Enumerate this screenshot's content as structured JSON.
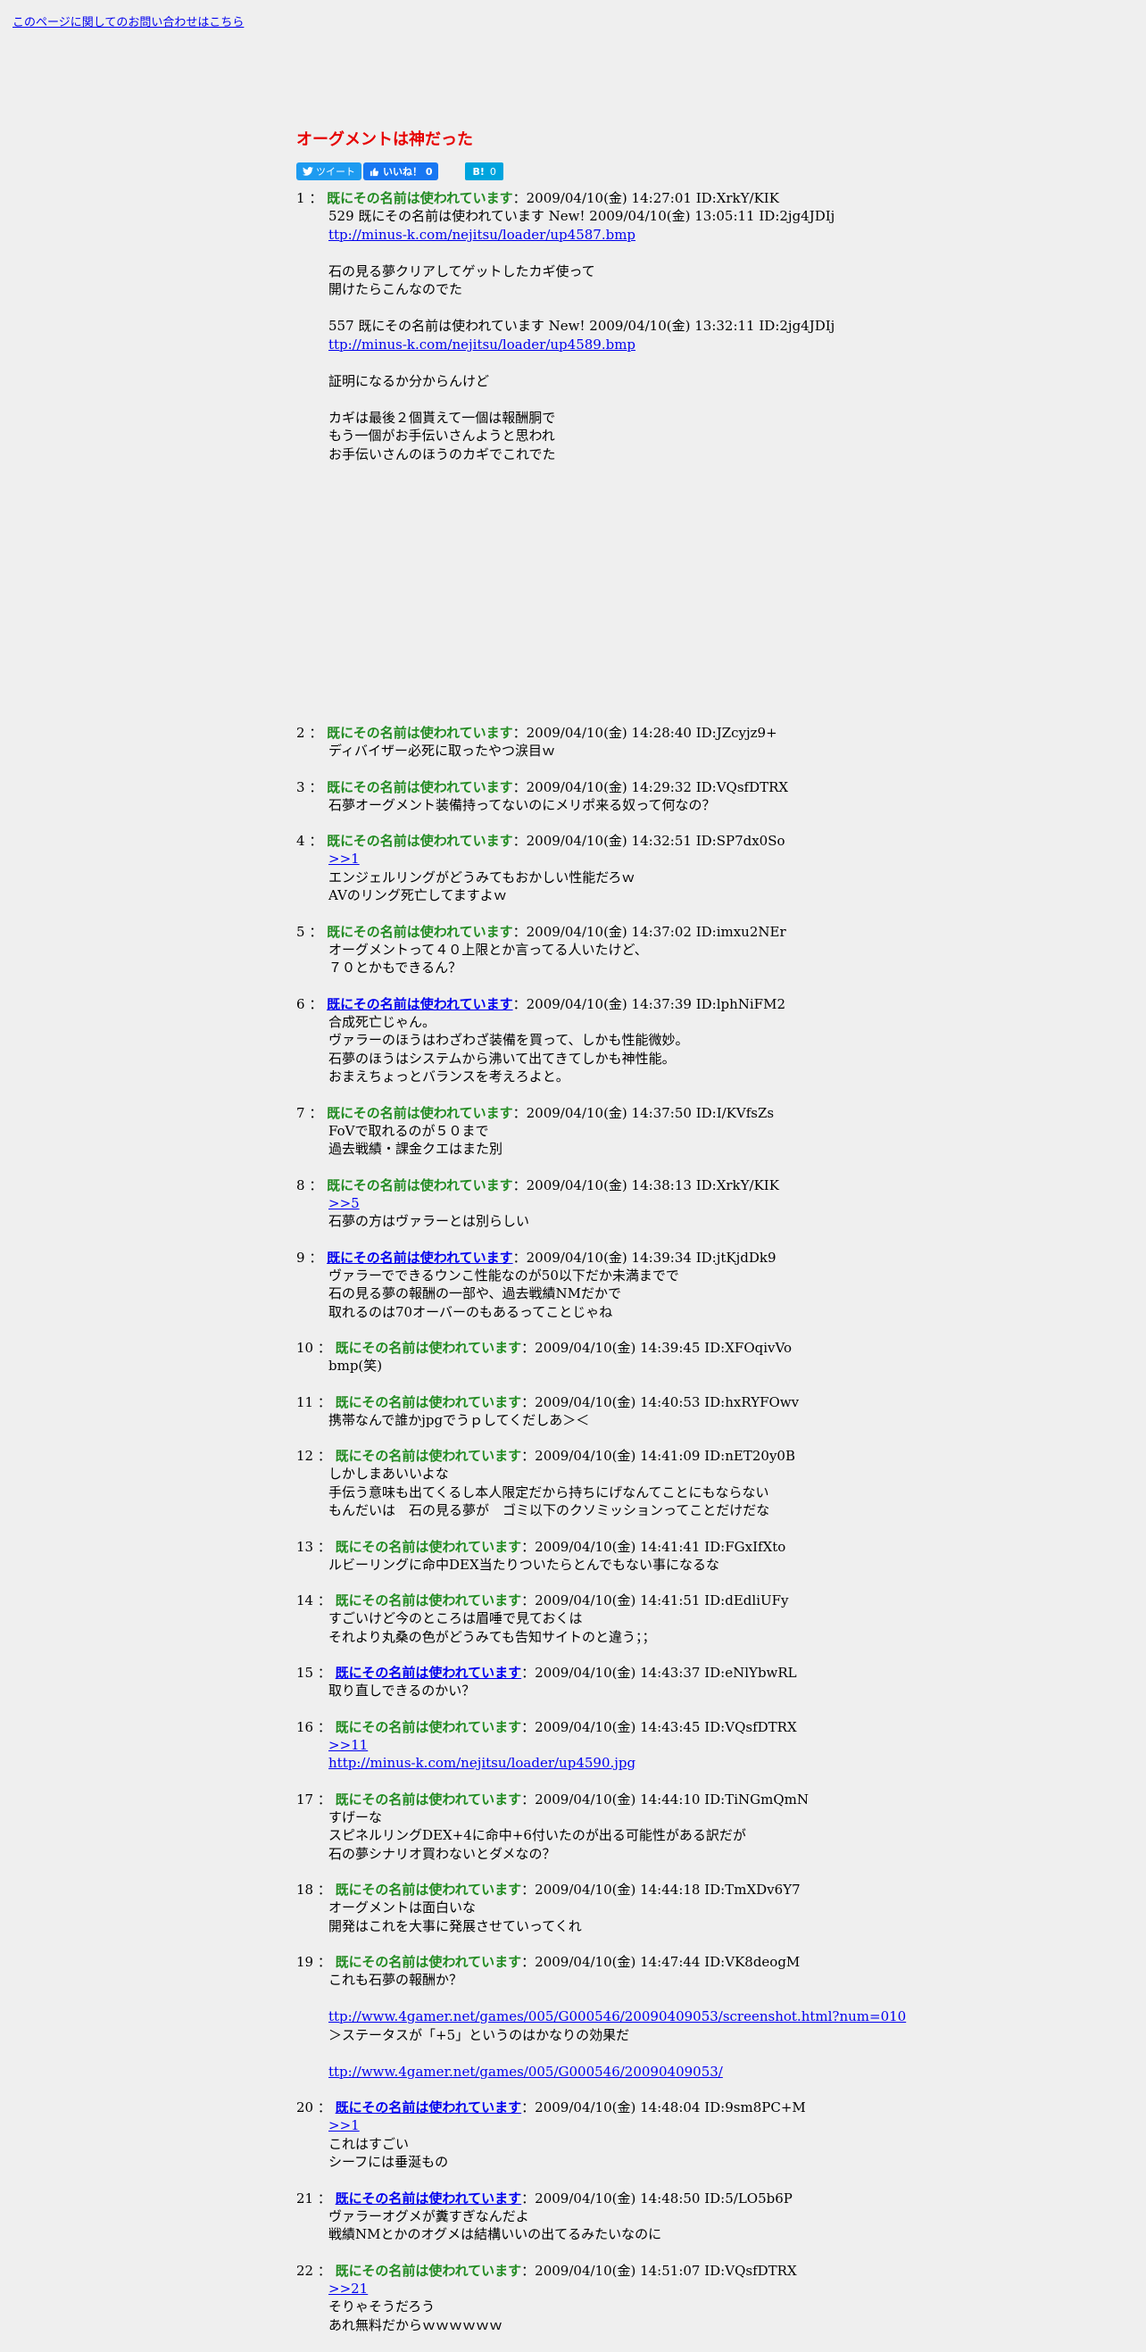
{
  "contact_link": "このページに関してのお問い合わせはこちら",
  "title": "オーグメントは神だった",
  "social": {
    "tweet": "ツイート",
    "like": "いいね！ 0",
    "hatena_label": "B!",
    "hatena_count": "0"
  },
  "posts": [
    {
      "num": "1",
      "name": "既にその名前は使われています",
      "link": false,
      "meta": "2009/04/10(金) 14:27:01 ID:XrkY/KIK",
      "lines": [
        {
          "t": "529 既にその名前は使われています New! 2009/04/10(金) 13:05:11 ID:2jg4JDIj"
        },
        {
          "t": "ttp://minus-k.com/nejitsu/loader/up4587.bmp",
          "link": true
        },
        {
          "t": ""
        },
        {
          "t": "石の見る夢クリアしてゲットしたカギ使って"
        },
        {
          "t": "開けたらこんなのでた"
        },
        {
          "t": ""
        },
        {
          "t": "557 既にその名前は使われています New! 2009/04/10(金) 13:32:11 ID:2jg4JDIj"
        },
        {
          "t": "ttp://minus-k.com/nejitsu/loader/up4589.bmp",
          "link": true
        },
        {
          "t": ""
        },
        {
          "t": "証明になるか分からんけど"
        },
        {
          "t": ""
        },
        {
          "t": "カギは最後２個貰えて一個は報酬胴で"
        },
        {
          "t": "もう一個がお手伝いさんようと思われ"
        },
        {
          "t": "お手伝いさんのほうのカギでこれでた"
        }
      ]
    },
    {
      "num": "2",
      "name": "既にその名前は使われています",
      "link": false,
      "meta": "2009/04/10(金) 14:28:40 ID:JZcyjz9+",
      "lines": [
        {
          "t": "ディバイザー必死に取ったやつ涙目ｗ"
        }
      ]
    },
    {
      "num": "3",
      "name": "既にその名前は使われています",
      "link": false,
      "meta": "2009/04/10(金) 14:29:32 ID:VQsfDTRX",
      "lines": [
        {
          "t": "石夢オーグメント装備持ってないのにメリポ来る奴って何なの？"
        }
      ]
    },
    {
      "num": "4",
      "name": "既にその名前は使われています",
      "link": false,
      "meta": "2009/04/10(金) 14:32:51 ID:SP7dx0So",
      "lines": [
        {
          "t": ">>1",
          "link": true
        },
        {
          "t": "エンジェルリングがどうみてもおかしい性能だろｗ"
        },
        {
          "t": "AVのリング死亡してますよｗ"
        }
      ]
    },
    {
      "num": "5",
      "name": "既にその名前は使われています",
      "link": false,
      "meta": "2009/04/10(金) 14:37:02 ID:imxu2NEr",
      "lines": [
        {
          "t": "オーグメントって４０上限とか言ってる人いたけど、"
        },
        {
          "t": "７０とかもできるん？"
        }
      ]
    },
    {
      "num": "6",
      "name": "既にその名前は使われています",
      "link": true,
      "meta": "2009/04/10(金) 14:37:39 ID:lphNiFM2",
      "lines": [
        {
          "t": "合成死亡じゃん。"
        },
        {
          "t": "ヴァラーのほうはわざわざ装備を買って、しかも性能微妙。"
        },
        {
          "t": "石夢のほうはシステムから沸いて出てきてしかも神性能。"
        },
        {
          "t": "おまえちょっとバランスを考えろよと。"
        }
      ]
    },
    {
      "num": "7",
      "name": "既にその名前は使われています",
      "link": false,
      "meta": "2009/04/10(金) 14:37:50 ID:I/KVfsZs",
      "lines": [
        {
          "t": "FoVで取れるのが５０まで"
        },
        {
          "t": "過去戦績・課金クエはまた別"
        }
      ]
    },
    {
      "num": "8",
      "name": "既にその名前は使われています",
      "link": false,
      "meta": "2009/04/10(金) 14:38:13 ID:XrkY/KIK",
      "lines": [
        {
          "t": ">>5",
          "link": true
        },
        {
          "t": "石夢の方はヴァラーとは別らしい"
        }
      ]
    },
    {
      "num": "9",
      "name": "既にその名前は使われています",
      "link": true,
      "meta": "2009/04/10(金) 14:39:34 ID:jtKjdDk9",
      "lines": [
        {
          "t": "ヴァラーでできるウンこ性能なのが50以下だか未満までで"
        },
        {
          "t": "石の見る夢の報酬の一部や、過去戦績NMだかで"
        },
        {
          "t": "取れるのは70オーバーのもあるってことじゃね"
        }
      ]
    },
    {
      "num": "10",
      "name": "既にその名前は使われています",
      "link": false,
      "meta": "2009/04/10(金) 14:39:45 ID:XFOqivVo",
      "lines": [
        {
          "t": "bmp(笑)"
        }
      ]
    },
    {
      "num": "11",
      "name": "既にその名前は使われています",
      "link": false,
      "meta": "2009/04/10(金) 14:40:53 ID:hxRYFOwv",
      "lines": [
        {
          "t": "携帯なんで誰かjpgでうｐしてくだしあ＞＜"
        }
      ]
    },
    {
      "num": "12",
      "name": "既にその名前は使われています",
      "link": false,
      "meta": "2009/04/10(金) 14:41:09 ID:nET20y0B",
      "lines": [
        {
          "t": "しかしまあいいよな"
        },
        {
          "t": "手伝う意味も出てくるし本人限定だから持ちにげなんてことにもならない"
        },
        {
          "t": "もんだいは　石の見る夢が　ゴミ以下のクソミッションってことだけだな"
        }
      ]
    },
    {
      "num": "13",
      "name": "既にその名前は使われています",
      "link": false,
      "meta": "2009/04/10(金) 14:41:41 ID:FGxIfXto",
      "lines": [
        {
          "t": "ルビーリングに命中DEX当たりついたらとんでもない事になるな"
        }
      ]
    },
    {
      "num": "14",
      "name": "既にその名前は使われています",
      "link": false,
      "meta": "2009/04/10(金) 14:41:51 ID:dEdliUFy",
      "lines": [
        {
          "t": "すごいけど今のところは眉唾で見ておくは"
        },
        {
          "t": "それより丸桑の色がどうみても告知サイトのと違う；；"
        }
      ]
    },
    {
      "num": "15",
      "name": "既にその名前は使われています",
      "link": true,
      "meta": "2009/04/10(金) 14:43:37 ID:eNlYbwRL",
      "lines": [
        {
          "t": "取り直しできるのかい？"
        }
      ]
    },
    {
      "num": "16",
      "name": "既にその名前は使われています",
      "link": false,
      "meta": "2009/04/10(金) 14:43:45 ID:VQsfDTRX",
      "lines": [
        {
          "t": ">>11",
          "link": true
        },
        {
          "t": "http://minus-k.com/nejitsu/loader/up4590.jpg",
          "link": true
        }
      ]
    },
    {
      "num": "17",
      "name": "既にその名前は使われています",
      "link": false,
      "meta": "2009/04/10(金) 14:44:10 ID:TiNGmQmN",
      "lines": [
        {
          "t": "すげーな"
        },
        {
          "t": "スピネルリングDEX+4に命中+6付いたのが出る可能性がある訳だが"
        },
        {
          "t": "石の夢シナリオ買わないとダメなの？"
        }
      ]
    },
    {
      "num": "18",
      "name": "既にその名前は使われています",
      "link": false,
      "meta": "2009/04/10(金) 14:44:18 ID:TmXDv6Y7",
      "lines": [
        {
          "t": "オーグメントは面白いな"
        },
        {
          "t": "開発はこれを大事に発展させていってくれ"
        }
      ]
    },
    {
      "num": "19",
      "name": "既にその名前は使われています",
      "link": false,
      "meta": "2009/04/10(金) 14:47:44 ID:VK8deogM",
      "lines": [
        {
          "t": "これも石夢の報酬か？"
        },
        {
          "t": ""
        },
        {
          "t": "ttp://www.4gamer.net/games/005/G000546/20090409053/screenshot.html?num=010",
          "link": true
        },
        {
          "t": "＞ステータスが「+5」というのはかなりの効果だ"
        },
        {
          "t": ""
        },
        {
          "t": "ttp://www.4gamer.net/games/005/G000546/20090409053/",
          "link": true
        }
      ]
    },
    {
      "num": "20",
      "name": "既にその名前は使われています",
      "link": true,
      "meta": "2009/04/10(金) 14:48:04 ID:9sm8PC+M",
      "lines": [
        {
          "t": ">>1",
          "link": true
        },
        {
          "t": "これはすごい"
        },
        {
          "t": "シーフには垂涎もの"
        }
      ]
    },
    {
      "num": "21",
      "name": "既にその名前は使われています",
      "link": true,
      "meta": "2009/04/10(金) 14:48:50 ID:5/LO5b6P",
      "lines": [
        {
          "t": "ヴァラーオグメが糞すぎなんだよ"
        },
        {
          "t": "戦績NMとかのオグメは結構いいの出てるみたいなのに"
        }
      ]
    },
    {
      "num": "22",
      "name": "既にその名前は使われています",
      "link": false,
      "meta": "2009/04/10(金) 14:51:07 ID:VQsfDTRX",
      "lines": [
        {
          "t": ">>21",
          "link": true
        },
        {
          "t": "そりゃそうだろう"
        },
        {
          "t": "あれ無料だからｗｗｗｗｗｗ"
        }
      ]
    }
  ]
}
